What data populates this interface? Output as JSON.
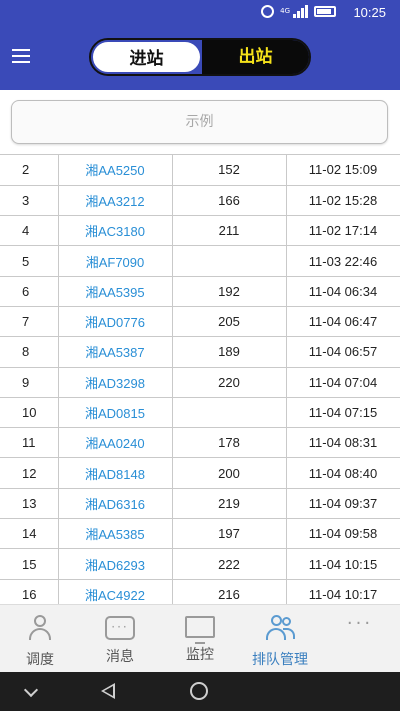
{
  "status_bar": {
    "time": "10:25",
    "network": "4G",
    "icons": [
      "alarm-icon",
      "signal-icon",
      "battery-icon"
    ]
  },
  "header": {
    "menu_icon": "menu-icon",
    "tabs": [
      {
        "label": "进站",
        "active": false
      },
      {
        "label": "出站",
        "active": true
      }
    ]
  },
  "search": {
    "placeholder": "示例"
  },
  "table": {
    "rows": [
      {
        "no": "2",
        "plate": "湘AA5250",
        "value": "152",
        "time": "11-02 15:09"
      },
      {
        "no": "3",
        "plate": "湘AA3212",
        "value": "166",
        "time": "11-02 15:28"
      },
      {
        "no": "4",
        "plate": "湘AC3180",
        "value": "211",
        "time": "11-02 17:14"
      },
      {
        "no": "5",
        "plate": "湘AF7090",
        "value": "",
        "time": "11-03 22:46"
      },
      {
        "no": "6",
        "plate": "湘AA5395",
        "value": "192",
        "time": "11-04 06:34"
      },
      {
        "no": "7",
        "plate": "湘AD0776",
        "value": "205",
        "time": "11-04 06:47"
      },
      {
        "no": "8",
        "plate": "湘AA5387",
        "value": "189",
        "time": "11-04 06:57"
      },
      {
        "no": "9",
        "plate": "湘AD3298",
        "value": "220",
        "time": "11-04 07:04"
      },
      {
        "no": "10",
        "plate": "湘AD0815",
        "value": "",
        "time": "11-04 07:15"
      },
      {
        "no": "11",
        "plate": "湘AA0240",
        "value": "178",
        "time": "11-04 08:31"
      },
      {
        "no": "12",
        "plate": "湘AD8148",
        "value": "200",
        "time": "11-04 08:40"
      },
      {
        "no": "13",
        "plate": "湘AD6316",
        "value": "219",
        "time": "11-04 09:37"
      },
      {
        "no": "14",
        "plate": "湘AA5385",
        "value": "197",
        "time": "11-04 09:58"
      },
      {
        "no": "15",
        "plate": "湘AD6293",
        "value": "222",
        "time": "11-04 10:15"
      },
      {
        "no": "16",
        "plate": "湘AC4922",
        "value": "216",
        "time": "11-04 10:17"
      }
    ]
  },
  "bottom_nav": {
    "items": [
      {
        "label": "调度",
        "icon": "user-icon",
        "active": false
      },
      {
        "label": "消息",
        "icon": "chat-icon",
        "active": false
      },
      {
        "label": "监控",
        "icon": "monitor-icon",
        "active": false
      },
      {
        "label": "排队管理",
        "icon": "users-icon",
        "active": true
      },
      {
        "label": "",
        "icon": "more-icon",
        "active": false
      }
    ]
  },
  "colors": {
    "primary": "#3a4ab8",
    "active_tab_bg": "#0a0a0a",
    "active_tab_text": "#f5e21a",
    "plate_text": "#2a8fd6"
  }
}
